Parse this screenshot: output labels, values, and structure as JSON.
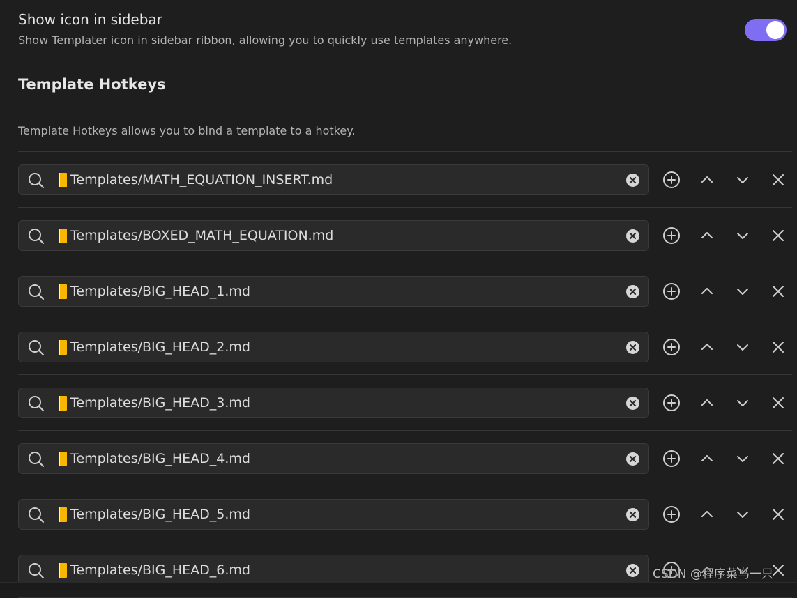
{
  "setting_sidebar": {
    "name": "Show icon in sidebar",
    "description": "Show Templater icon in sidebar ribbon, allowing you to quickly use templates anywhere.",
    "enabled": true,
    "accent_color": "#7f6df2"
  },
  "hotkeys_section": {
    "heading": "Template Hotkeys",
    "description": "Template Hotkeys allows you to bind a template to a hotkey."
  },
  "hotkeys": [
    {
      "template": "Templates/MATH_EQUATION_INSERT.md"
    },
    {
      "template": "Templates/BOXED_MATH_EQUATION.md"
    },
    {
      "template": "Templates/BIG_HEAD_1.md"
    },
    {
      "template": "Templates/BIG_HEAD_2.md"
    },
    {
      "template": "Templates/BIG_HEAD_3.md"
    },
    {
      "template": "Templates/BIG_HEAD_4.md"
    },
    {
      "template": "Templates/BIG_HEAD_5.md"
    },
    {
      "template": "Templates/BIG_HEAD_6.md"
    }
  ],
  "icons": {
    "search": "search-icon",
    "folder_marker": "folder-marker-icon",
    "clear": "clear-circle-x-icon",
    "add": "plus-circle-icon",
    "move_up": "chevron-up-icon",
    "move_down": "chevron-down-icon",
    "delete": "close-x-icon"
  },
  "watermark": "CSDN @程序菜鸟一只"
}
